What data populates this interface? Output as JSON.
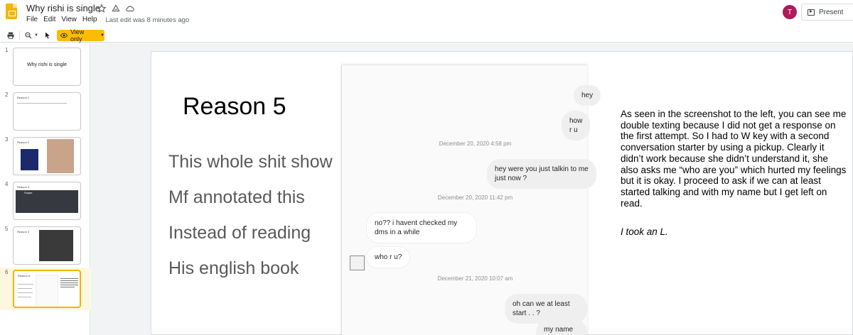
{
  "header": {
    "title": "Why rishi is single",
    "menus": [
      "File",
      "Edit",
      "View",
      "Help"
    ],
    "last_edit": "Last edit was 8 minutes ago",
    "avatar_letter": "T",
    "present_label": "Present"
  },
  "toolbar": {
    "view_only_label": "View only"
  },
  "filmstrip": {
    "slides": [
      {
        "num": "1",
        "title": "Why rishi is single"
      },
      {
        "num": "2",
        "title": "Reason 1"
      },
      {
        "num": "3",
        "title": "Reason 2"
      },
      {
        "num": "4",
        "title": "Reason 3",
        "caption": "Sniper"
      },
      {
        "num": "5",
        "title": "Reason 4"
      },
      {
        "num": "6",
        "title": "Reason 5"
      }
    ]
  },
  "slide": {
    "title": "Reason 5",
    "lines": [
      "This whole shit show",
      "Mf annotated this",
      "Instead of reading",
      "His english book"
    ],
    "chat": {
      "messages": [
        {
          "text": "hey"
        },
        {
          "text": "how r u"
        },
        {
          "text": "December 20, 2020 4:58 pm"
        },
        {
          "text": "hey were you just talkin to me just now ?"
        },
        {
          "text": "December 20, 2020 11:42 pm"
        },
        {
          "text": "no?? i havent checked my dms in a while"
        },
        {
          "text": "who r u?"
        },
        {
          "text": "December 21, 2020 10:07 am"
        },
        {
          "text": "oh can we at least start . . ?"
        },
        {
          "text": "my name is rishi"
        }
      ]
    },
    "explanation": "As seen in the screenshot to the left, you can see me double texting because I did not get a response on the first attempt. So I had to W key with a second conversation starter by using a pickup. Clearly it didn’t work because she didn’t understand it, she also asks me “who are you” which hurted my feelings but it is okay. I proceed to ask if we can at least started talking and with my name but I get left on read.",
    "conclusion": "I took an L."
  },
  "colors": {
    "accent": "#fbbc04",
    "avatar": "#b0195a",
    "selected_thumb_border": "#f4b400"
  }
}
